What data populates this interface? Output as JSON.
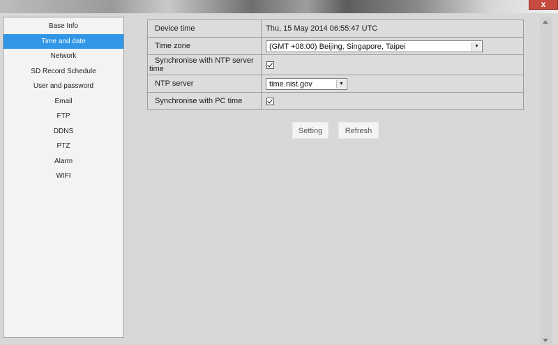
{
  "window": {
    "close_glyph": "x"
  },
  "sidebar": {
    "items": [
      {
        "label": "Base Info",
        "active": false
      },
      {
        "label": "Time and date",
        "active": true
      },
      {
        "label": "Network",
        "active": false
      },
      {
        "label": "SD Record Schedule",
        "active": false
      },
      {
        "label": "User and password",
        "active": false
      },
      {
        "label": "Email",
        "active": false
      },
      {
        "label": "FTP",
        "active": false
      },
      {
        "label": "DDNS",
        "active": false
      },
      {
        "label": "PTZ",
        "active": false
      },
      {
        "label": "Alarm",
        "active": false
      },
      {
        "label": "WIFI",
        "active": false
      }
    ],
    "active_color": "#2f96e8"
  },
  "form": {
    "device_time": {
      "label": "Device time",
      "value": "Thu, 15 May 2014 06:55:47 UTC"
    },
    "time_zone": {
      "label": "Time zone",
      "value": "(GMT +08:00) Beijing, Singapore, Taipei"
    },
    "sync_ntp": {
      "label_line1": "Synchronise with NTP server",
      "label_line2": "time",
      "checked": true
    },
    "ntp_server": {
      "label": "NTP server",
      "value": "time.nist.gov"
    },
    "sync_pc": {
      "label": "Synchronise with PC time",
      "checked": true
    }
  },
  "buttons": {
    "setting": "Setting",
    "refresh": "Refresh"
  },
  "icons": {
    "dropdown": "chevron-down-icon",
    "check": "check-icon",
    "scroll_up": "scroll-up-icon",
    "scroll_down": "scroll-down-icon"
  }
}
